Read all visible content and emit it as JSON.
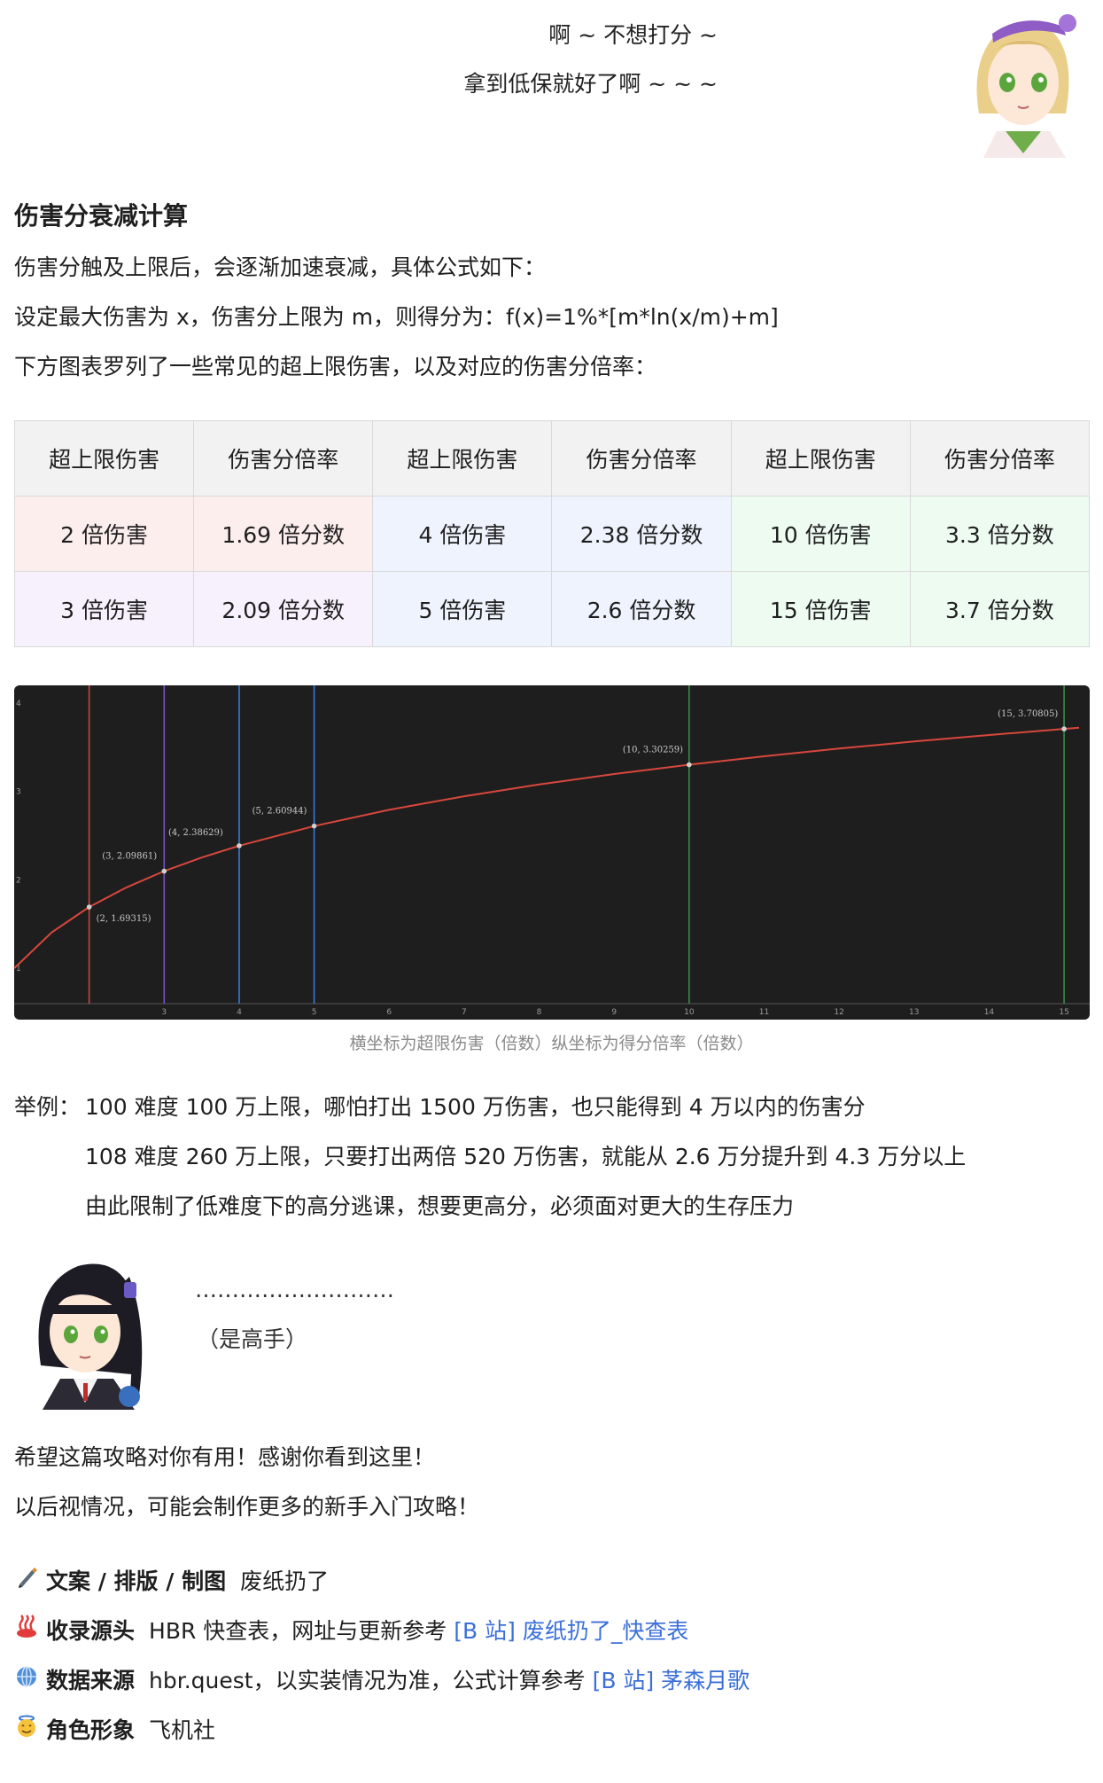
{
  "top_dialog": {
    "line1": "啊 ~ 不想打分 ~",
    "line2": "拿到低保就好了啊 ~ ~ ~"
  },
  "section": {
    "title": "伤害分衰减计算",
    "p1": "伤害分触及上限后，会逐渐加速衰减，具体公式如下：",
    "p2": "设定最大伤害为 x，伤害分上限为 m，则得分为：f(x)=1%*[m*ln(x/m)+m]",
    "p3": "下方图表罗列了一些常见的超上限伤害，以及对应的伤害分倍率："
  },
  "table": {
    "headers": [
      "超上限伤害",
      "伤害分倍率",
      "超上限伤害",
      "伤害分倍率",
      "超上限伤害",
      "伤害分倍率"
    ],
    "rows": [
      [
        "2 倍伤害",
        "1.69 倍分数",
        "4 倍伤害",
        "2.38 倍分数",
        "10 倍伤害",
        "3.3 倍分数"
      ],
      [
        "3 倍伤害",
        "2.09 倍分数",
        "5 倍伤害",
        "2.6 倍分数",
        "15 倍伤害",
        "3.7 倍分数"
      ]
    ]
  },
  "chart_data": {
    "type": "line",
    "title": "",
    "xlabel": "",
    "ylabel": "",
    "xlim": [
      1,
      15.2
    ],
    "ylim": [
      0.6,
      4.1
    ],
    "x_ticks": [
      "3",
      "4",
      "5",
      "6",
      "7",
      "8",
      "9",
      "10",
      "11",
      "12",
      "13",
      "14",
      "15"
    ],
    "y_ticks": [
      "1",
      "2",
      "3",
      "4"
    ],
    "series": [
      {
        "x": [
          1,
          1.5,
          2,
          2.5,
          3,
          3.5,
          4,
          5,
          6,
          7,
          8,
          9,
          10,
          11,
          12,
          13,
          14,
          15,
          15.2
        ],
        "y": [
          1,
          1.405,
          1.693,
          1.916,
          2.099,
          2.253,
          2.386,
          2.609,
          2.792,
          2.946,
          3.079,
          3.197,
          3.303,
          3.398,
          3.485,
          3.565,
          3.639,
          3.708,
          3.721
        ]
      }
    ],
    "points": [
      {
        "x": 2,
        "y": 1.69315,
        "label": "(2, 1.69315)"
      },
      {
        "x": 3,
        "y": 2.09861,
        "label": "(3, 2.09861)"
      },
      {
        "x": 4,
        "y": 2.38629,
        "label": "(4, 2.38629)"
      },
      {
        "x": 5,
        "y": 2.60944,
        "label": "(5, 2.60944)"
      },
      {
        "x": 10,
        "y": 3.30259,
        "label": "(10, 3.30259)"
      },
      {
        "x": 15,
        "y": 3.70805,
        "label": "(15, 3.70805)"
      }
    ],
    "vlines": [
      {
        "x": 2,
        "color": "#c44a3e"
      },
      {
        "x": 3,
        "color": "#7a4ec4"
      },
      {
        "x": 4,
        "color": "#3a7bd5"
      },
      {
        "x": 5,
        "color": "#3a7bd5"
      },
      {
        "x": 10,
        "color": "#3c8c4a"
      },
      {
        "x": 15,
        "color": "#3c8c4a"
      }
    ],
    "line_color": "#d8473c"
  },
  "caption": "横坐标为超限伤害（倍数）纵坐标为得分倍率（倍数）",
  "example": {
    "prefix": "举例：",
    "line1": "100 难度 100 万上限，哪怕打出 1500 万伤害，也只能得到 4 万以内的伤害分",
    "line2": "108 难度 260 万上限，只要打出两倍 520 万伤害，就能从 2.6 万分提升到 4.3 万分以上",
    "line3": "由此限制了低难度下的高分逃课，想要更高分，必须面对更大的生存压力"
  },
  "bottom_dialog": {
    "line1": "………………………",
    "line2": "（是高手）"
  },
  "closing": {
    "line1": "希望这篇攻略对你有用！感谢你看到这里！",
    "line2": "以后视情况，可能会制作更多的新手入门攻略！"
  },
  "credits": [
    {
      "icon": "pen-icon",
      "title": "文案 / 排版 / 制图",
      "text": "废纸扔了",
      "link": ""
    },
    {
      "icon": "hot-springs-icon",
      "title": "收录源头",
      "text": "HBR 快查表，网址与更新参考",
      "link": "[B 站] 废纸扔了_快查表"
    },
    {
      "icon": "globe-icon",
      "title": "数据来源",
      "text": "hbr.quest，以实装情况为准，公式计算参考",
      "link": "[B 站] 茅森月歌"
    },
    {
      "icon": "angel-face-icon",
      "title": "角色形象",
      "text": "飞机社",
      "link": ""
    }
  ]
}
